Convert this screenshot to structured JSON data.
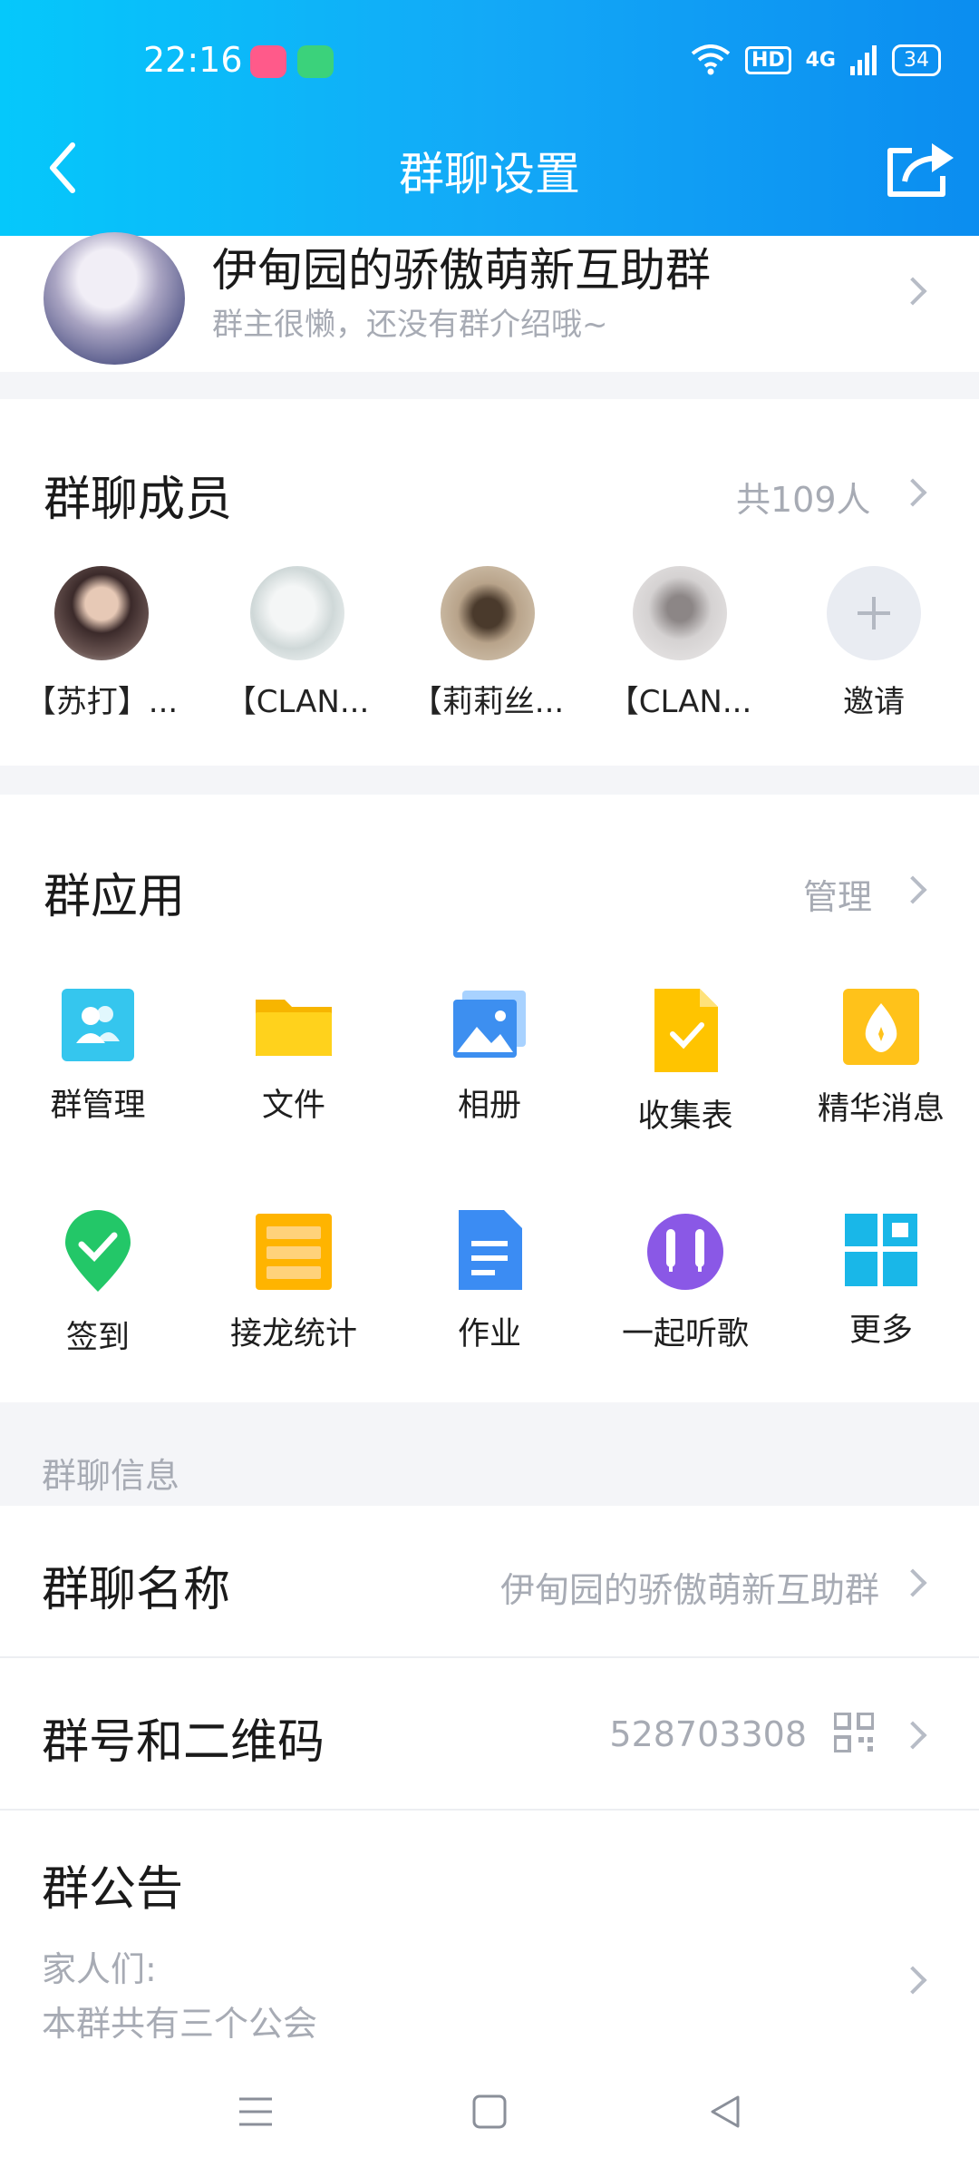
{
  "status": {
    "time": "22:16",
    "hd": "HD",
    "network": "4G",
    "battery": "34"
  },
  "header": {
    "title": "群聊设置"
  },
  "group": {
    "name": "伊甸园的骄傲萌新互助群",
    "description": "群主很懒，还没有群介绍哦~"
  },
  "members": {
    "title": "群聊成员",
    "count": "共109人",
    "list": [
      {
        "name": "【苏打】..."
      },
      {
        "name": "【CLAN..."
      },
      {
        "name": "【莉莉丝..."
      },
      {
        "name": "【CLAN..."
      },
      {
        "name": "邀请"
      }
    ]
  },
  "apps": {
    "title": "群应用",
    "manage": "管理",
    "items": [
      {
        "label": "群管理",
        "icon": "group-manage-icon"
      },
      {
        "label": "文件",
        "icon": "folder-icon"
      },
      {
        "label": "相册",
        "icon": "album-icon"
      },
      {
        "label": "收集表",
        "icon": "form-icon"
      },
      {
        "label": "精华消息",
        "icon": "essence-icon"
      },
      {
        "label": "签到",
        "icon": "checkin-icon"
      },
      {
        "label": "接龙统计",
        "icon": "relay-icon"
      },
      {
        "label": "作业",
        "icon": "homework-icon"
      },
      {
        "label": "一起听歌",
        "icon": "music-icon"
      },
      {
        "label": "更多",
        "icon": "more-icon"
      }
    ]
  },
  "info": {
    "section_label": "群聊信息",
    "name_row": {
      "title": "群聊名称",
      "value": "伊甸园的骄傲萌新互助群"
    },
    "number_row": {
      "title": "群号和二维码",
      "value": "528703308"
    },
    "notice_row": {
      "title": "群公告",
      "line1": "家人们:",
      "line2": "本群共有三个公会"
    }
  }
}
